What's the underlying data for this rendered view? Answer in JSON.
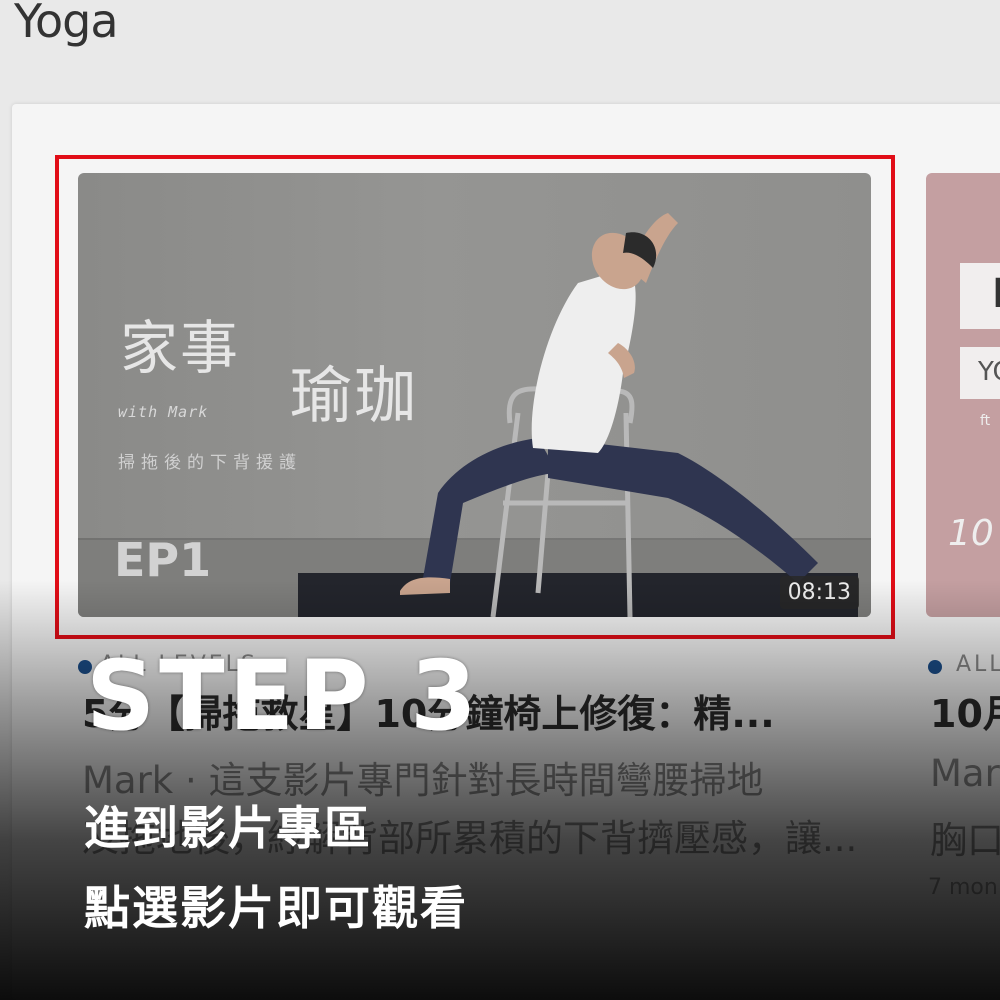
{
  "page": {
    "title": "Yoga"
  },
  "cards": [
    {
      "thumbnail": {
        "title_line1": "家事",
        "title_line2": "瑜珈",
        "with": "with Mark",
        "subtitle": "掃拖後的下背援護",
        "episode": "EP1",
        "duration": "08:13"
      },
      "category": "ALL LEVELS",
      "title": "5分【掃拖救星】10分鐘椅上修復：精...",
      "description_line1": "Mark · 這支影片專門針對長時間彎腰掃地",
      "description_line2": "及拖地後，紓解背部所累積的下背擠壓感，讓..."
    },
    {
      "thumbnail": {
        "box1_text": "E",
        "box2_text": "YC",
        "ft_text": "ft",
        "number": "10"
      },
      "category": "ALL",
      "title": "10月",
      "description_line1": "Mar",
      "description_line2": "胸口",
      "time": "7 mon"
    }
  ],
  "overlay": {
    "step": "STEP 3",
    "line1": "進到影片專區",
    "line2": "點選影片即可觀看"
  },
  "colors": {
    "highlight": "#e10d17",
    "category_dot": "#1c4f8c"
  }
}
